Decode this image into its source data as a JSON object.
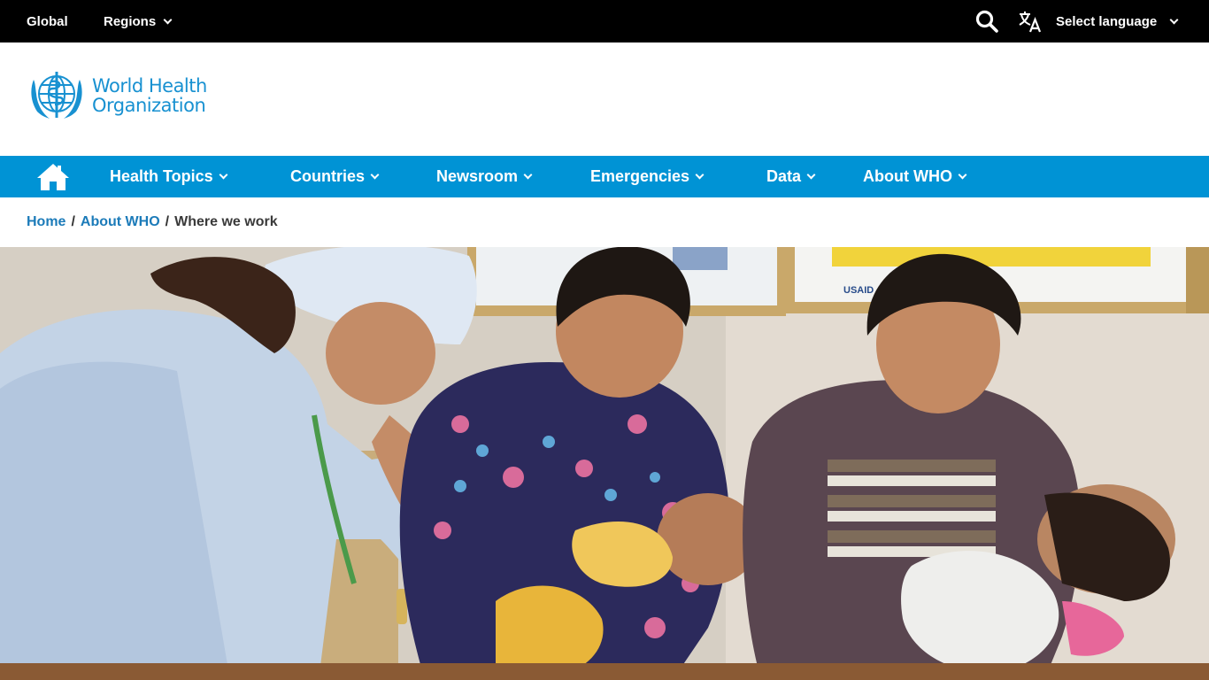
{
  "topbar": {
    "global_label": "Global",
    "regions_label": "Regions",
    "select_language_label": "Select language",
    "icons": {
      "search": "search-icon",
      "translate": "translate-icon",
      "chevron": "chevron-down-icon"
    }
  },
  "header": {
    "logo_line1": "World Health",
    "logo_line2": "Organization",
    "logo_color": "#1891d1"
  },
  "main_nav": {
    "background_color": "#0093d5",
    "home_icon": "home-icon",
    "items": [
      {
        "label": "Health Topics"
      },
      {
        "label": "Countries"
      },
      {
        "label": "Newsroom"
      },
      {
        "label": "Emergencies"
      },
      {
        "label": "Data"
      },
      {
        "label": "About WHO"
      }
    ]
  },
  "breadcrumb": {
    "items": [
      {
        "label": "Home"
      },
      {
        "label": "About WHO"
      }
    ],
    "current": "Where we work",
    "separator": "/"
  },
  "hero": {
    "poster_logo_text": "USAID"
  }
}
